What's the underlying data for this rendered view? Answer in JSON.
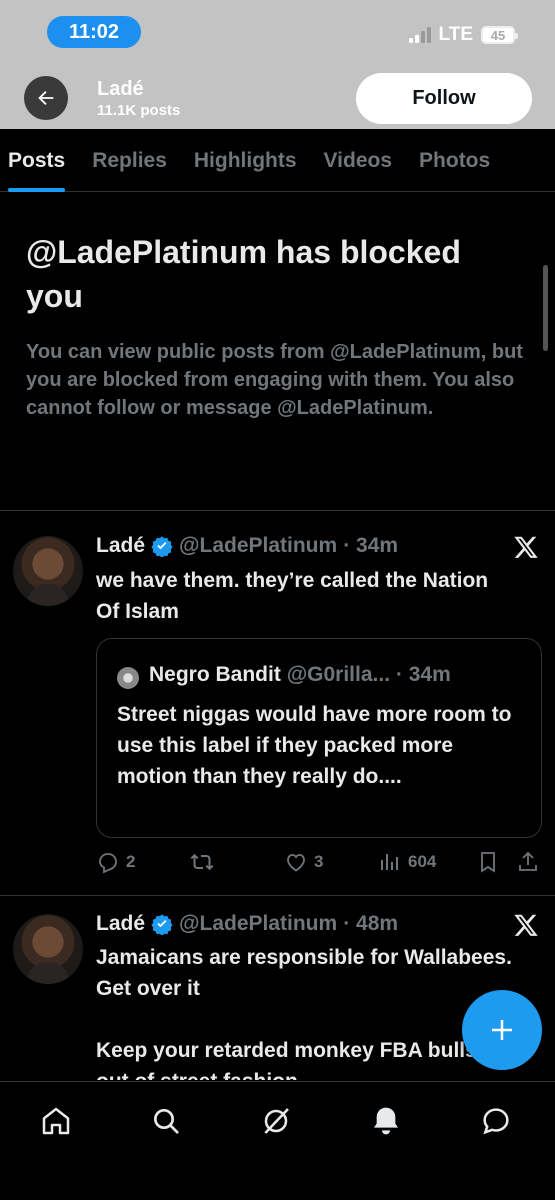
{
  "status_bar": {
    "time": "11:02",
    "network": "LTE",
    "battery": "45"
  },
  "header": {
    "back_icon": "arrow-left-icon",
    "name": "Ladé",
    "posts_count": "11.1K posts",
    "follow_label": "Follow"
  },
  "tabs": [
    {
      "label": "Posts",
      "active": true
    },
    {
      "label": "Replies",
      "active": false
    },
    {
      "label": "Highlights",
      "active": false
    },
    {
      "label": "Videos",
      "active": false
    },
    {
      "label": "Photos",
      "active": false
    }
  ],
  "blocked": {
    "title": "@LadePlatinum has blocked you",
    "description": "You can view public posts from @LadePlatinum, but you are blocked from engaging with them. You also cannot follow or message @LadePlatinum."
  },
  "posts": [
    {
      "name": "Ladé",
      "handle": "@LadePlatinum",
      "time": "· 34m",
      "text": "we have them. they’re called the Nation Of Islam",
      "quote": {
        "name": "Negro Bandit",
        "handle": "@G0rilla...",
        "time": "· 34m",
        "text": "Street niggas would have more room to use this label if they packed more motion than they really do...."
      },
      "actions": {
        "replies": "2",
        "reposts": "",
        "likes": "3",
        "views": "604"
      }
    },
    {
      "name": "Ladé",
      "handle": "@LadePlatinum",
      "time": "· 48m",
      "text": "Jamaicans are responsible for Wallabees. Get over it\n\nKeep your retarded monkey FBA bullshit out of street fashion"
    }
  ],
  "colors": {
    "accent": "#1d9bf0",
    "muted": "#71767b",
    "background": "#000000",
    "header_overlay": "#c3c3c3"
  },
  "nav": [
    "home-icon",
    "search-icon",
    "grok-icon",
    "notifications-icon",
    "messages-icon"
  ]
}
